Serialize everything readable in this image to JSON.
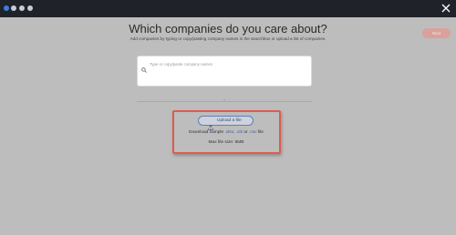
{
  "header": {
    "title": "Which companies do you care about?",
    "subtitle": "Add companies by typing or copy/pasting company names in the searchbox or upload a list of companies.",
    "next_label": "Next"
  },
  "search": {
    "placeholder": "Type or copy/paste company names"
  },
  "upload": {
    "button_label": "Upload a file",
    "sample_prefix": "Download sample",
    "format_xlsx": ".xlsx",
    "sep1": ",",
    "format_xls": ".xls",
    "or_text": "or",
    "format_csv": ".csv",
    "file_suffix": "file",
    "max_size": "Max file size: 6MB"
  },
  "colors": {
    "topbar": "#1f2228",
    "overlay": "#bdbdbd",
    "highlight": "#e05b4f",
    "link": "#3a5fa8"
  },
  "icons": {
    "close": "close-icon",
    "search": "search-icon",
    "upload": "upload-icon"
  }
}
